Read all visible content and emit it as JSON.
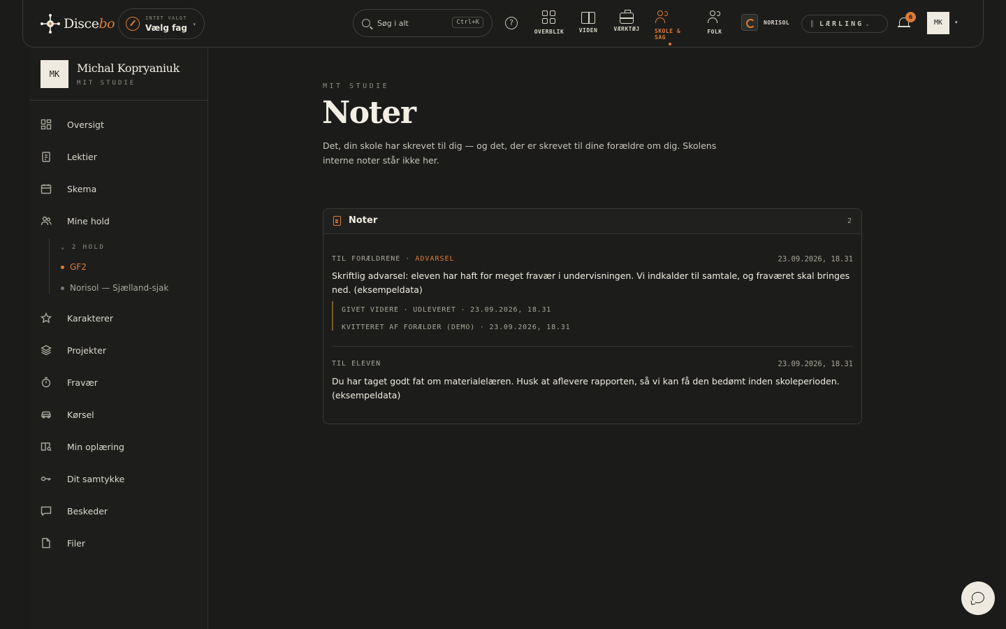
{
  "header": {
    "logo": {
      "main": "Disce",
      "accent": "bo"
    },
    "course_picker": {
      "small": "INTET VALGT",
      "label": "Vælg fag",
      "caret": "▾"
    },
    "search": {
      "label": "Søg i alt",
      "shortcut": "Ctrl+K"
    },
    "help": "?",
    "nav": [
      {
        "label": "OVERBLIK",
        "icon": "grid-icon"
      },
      {
        "label": "VIDEN",
        "icon": "book-icon"
      },
      {
        "label": "VÆRKTØJ",
        "icon": "briefcase-icon"
      },
      {
        "label_l1": "SKOLE &",
        "label_l2": "SAG",
        "icon": "people-icon",
        "active": true
      },
      {
        "label": "FOLK",
        "icon": "people-icon"
      }
    ],
    "org": {
      "name": "NORISOL"
    },
    "role": {
      "label": "LÆRLING",
      "caret": "⌄"
    },
    "notifications": {
      "count": "6"
    },
    "user": {
      "initials": "MK",
      "caret": "▾"
    }
  },
  "sidebar": {
    "profile": {
      "initials": "MK",
      "name": "Michal Kopryaniuk",
      "subtitle": "MIT STUDIE"
    },
    "items": [
      {
        "label": "Oversigt",
        "icon": "dashboard-icon"
      },
      {
        "label": "Lektier",
        "icon": "clipboard-icon"
      },
      {
        "label": "Skema",
        "icon": "calendar-icon"
      },
      {
        "label": "Mine hold",
        "icon": "group-icon"
      },
      {
        "label": "Karakterer",
        "icon": "star-icon"
      },
      {
        "label": "Projekter",
        "icon": "layers-icon"
      },
      {
        "label": "Fravær",
        "icon": "timer-icon"
      },
      {
        "label": "Kørsel",
        "icon": "car-icon"
      },
      {
        "label": "Min oplæring",
        "icon": "training-icon"
      },
      {
        "label": "Dit samtykke",
        "icon": "key-icon"
      },
      {
        "label": "Beskeder",
        "icon": "message-icon"
      },
      {
        "label": "Filer",
        "icon": "file-icon"
      }
    ],
    "teams": {
      "header": "2 HOLD",
      "items": [
        {
          "label": "GF2",
          "color": "#e07b35"
        },
        {
          "label": "Norisol — Sjælland-sjak",
          "color": "#6f7a85"
        }
      ]
    }
  },
  "main": {
    "eyebrow": "MIT STUDIE",
    "title": "Noter",
    "description": "Det, din skole har skrevet til dig — og det, der er skrevet til dine forældre om dig. Skolens interne noter står ikke her.",
    "card": {
      "title": "Noter",
      "count": "2",
      "notes": [
        {
          "recipient": "TIL FORÆLDRENE",
          "separator": "·",
          "tag": "ADVARSEL",
          "date": "23.09.2026, 18.31",
          "body": "Skriftlig advarsel: eleven har haft for meget fravær i undervisningen. Vi indkalder til samtale, og fraværet skal bringes ned. (eksempeldata)",
          "trail": [
            "GIVET VIDERE · UDLEVERET · 23.09.2026, 18.31",
            "KVITTERET AF FORÆLDER (DEMO) · 23.09.2026, 18.31"
          ]
        },
        {
          "recipient": "TIL ELEVEN",
          "date": "23.09.2026, 18.31",
          "body": "Du har taget godt fat om materialelæren. Husk at aflevere rapporten, så vi kan få den bedømt inden skoleperioden. (eksempeldata)"
        }
      ]
    }
  },
  "colors": {
    "accent": "#e07b35",
    "background": "#1b1c1a",
    "text": "#e8e4d8"
  }
}
